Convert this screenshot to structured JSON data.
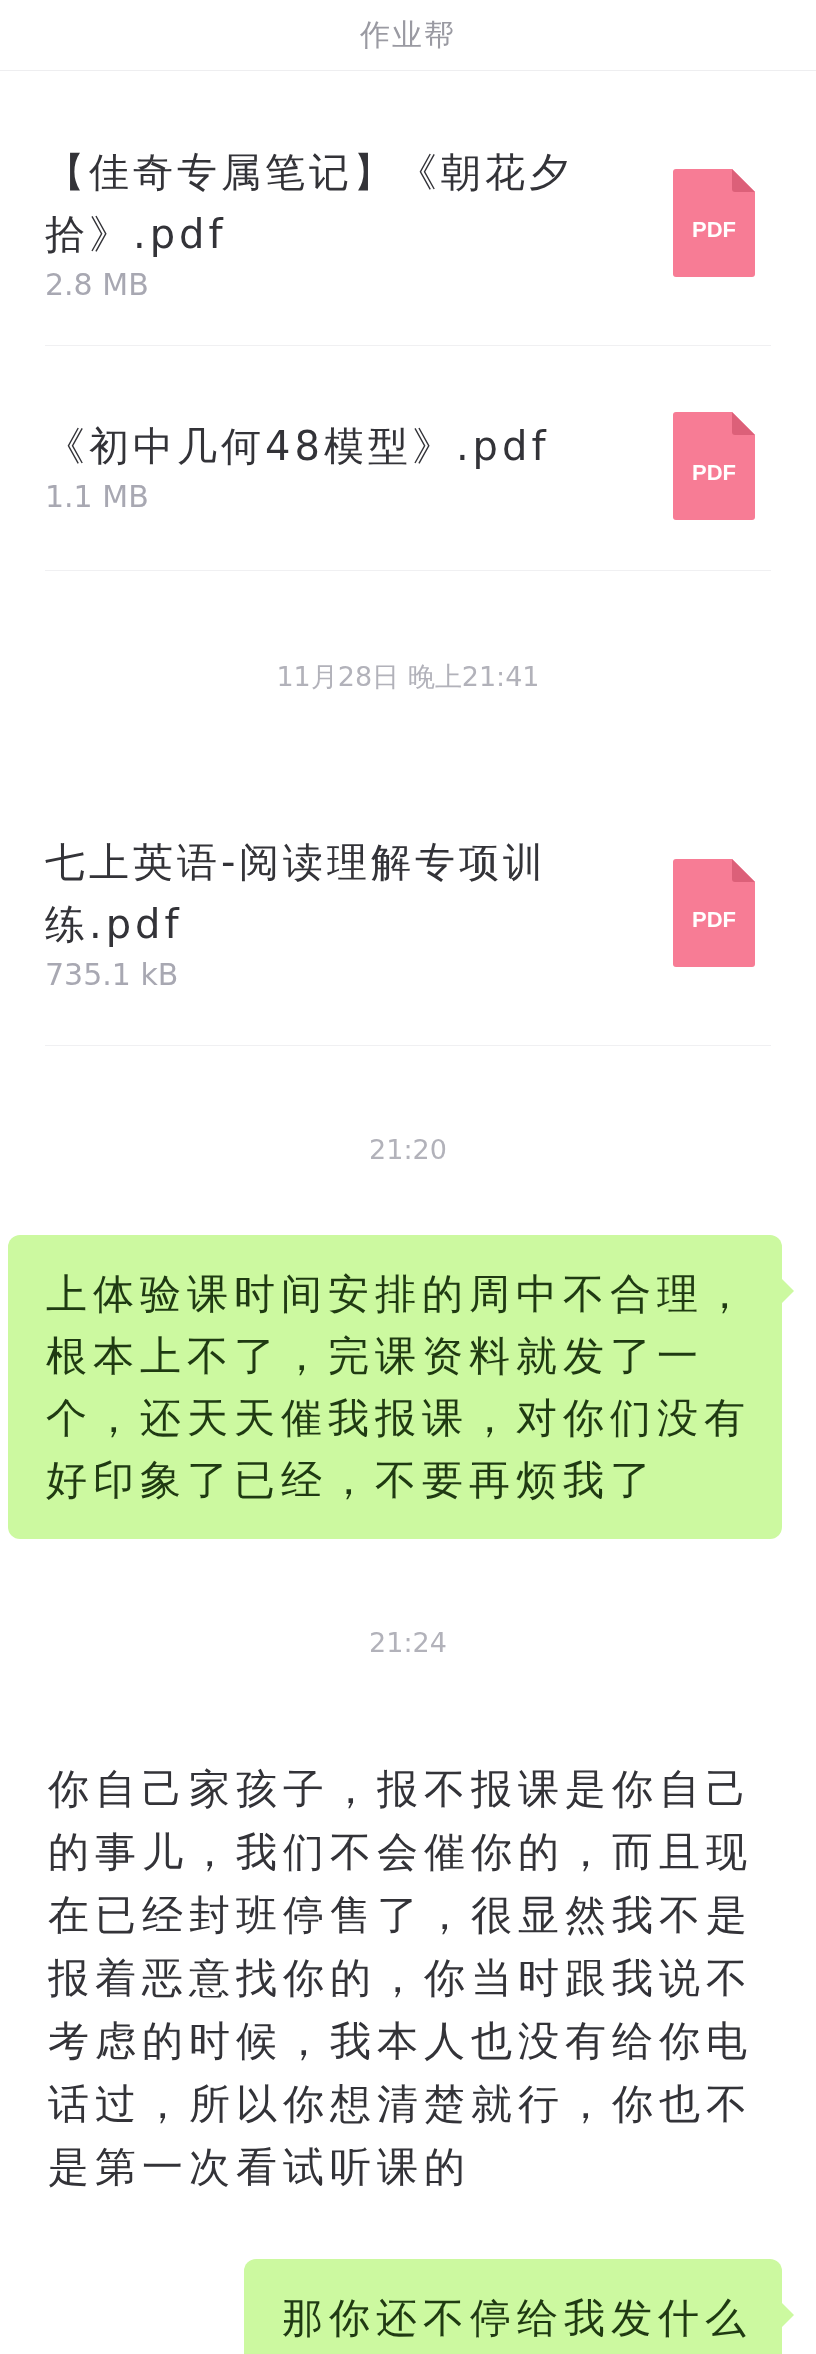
{
  "header": {
    "title": "作业帮"
  },
  "messages": [
    {
      "kind": "file",
      "name": "【佳奇专属笔记】《朝花夕拾》.pdf",
      "size": "2.8 MB",
      "icon_label": "PDF"
    },
    {
      "kind": "file",
      "name": "《初中几何48模型》.pdf",
      "size": "1.1 MB",
      "icon_label": "PDF"
    },
    {
      "kind": "time",
      "text": "11月28日 晚上21:41"
    },
    {
      "kind": "file",
      "name": "七上英语-阅读理解专项训练.pdf",
      "size": "735.1 kB",
      "icon_label": "PDF"
    },
    {
      "kind": "time",
      "text": "21:20"
    },
    {
      "kind": "outgoing",
      "text": "上体验课时间安排的周中不合理，根本上不了，完课资料就发了一个，还天天催我报课，对你们没有好印象了已经，不要再烦我了"
    },
    {
      "kind": "time",
      "text": "21:24"
    },
    {
      "kind": "incoming",
      "text": "你自己家孩子，报不报课是你自己的事儿，我们不会催你的，而且现在已经封班停售了，很显然我不是报着恶意找你的，你当时跟我说不考虑的时候，我本人也没有给你电话过，所以你想清楚就行，你也不是第一次看试听课的"
    },
    {
      "kind": "outgoing",
      "text": "那你还不停给我发什么"
    }
  ]
}
